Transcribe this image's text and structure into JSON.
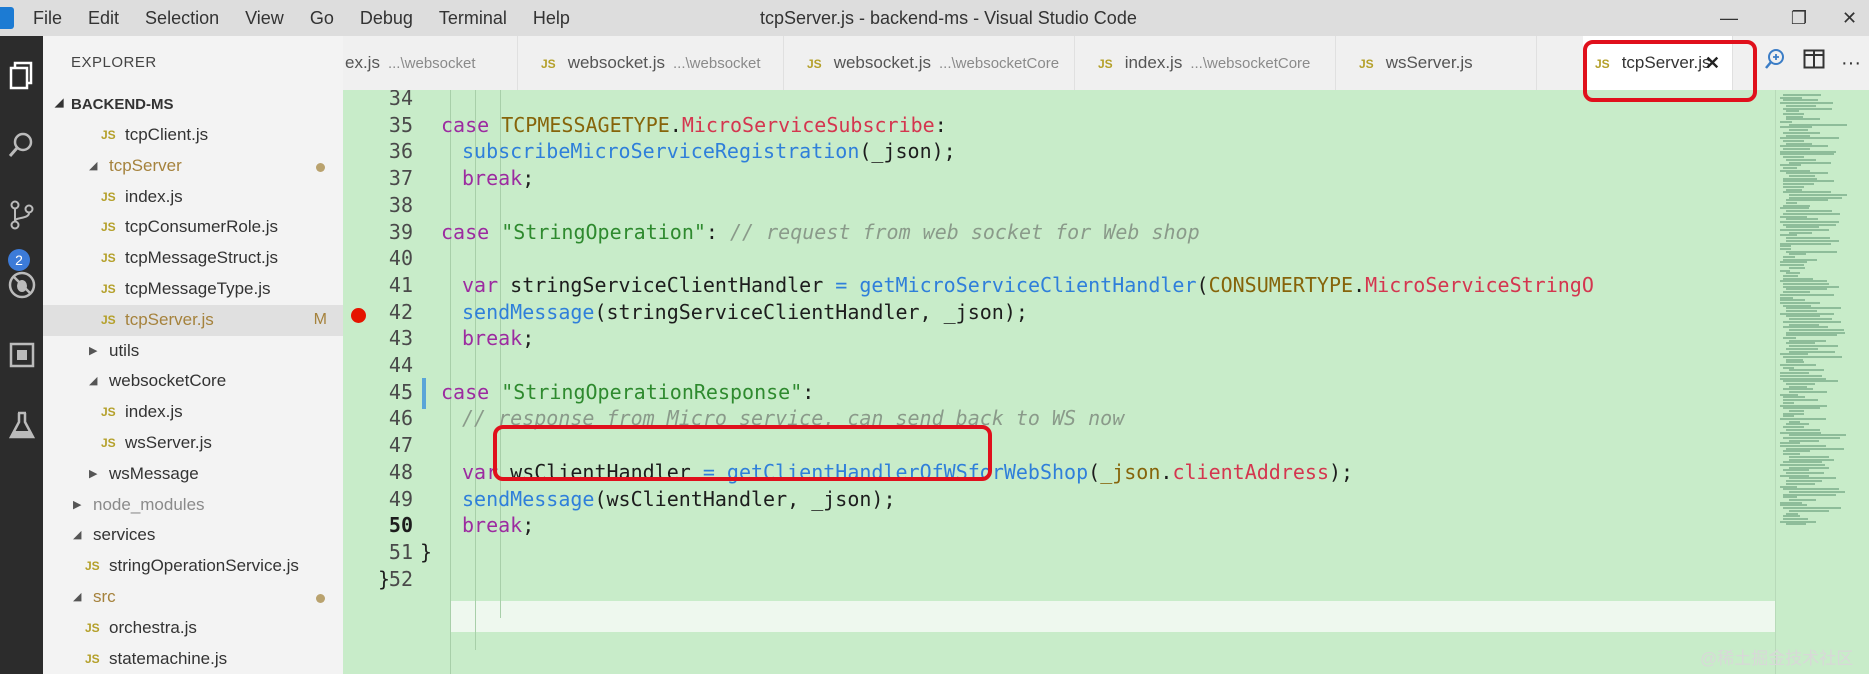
{
  "window": {
    "title": "tcpServer.js - backend-ms - Visual Studio Code",
    "menu": [
      "File",
      "Edit",
      "Selection",
      "View",
      "Go",
      "Debug",
      "Terminal",
      "Help"
    ],
    "controls": {
      "minimize": "—",
      "restore": "❐",
      "close": "✕"
    }
  },
  "activity_bar": {
    "icons": [
      "explorer-icon",
      "search-icon",
      "source-control-icon",
      "debug-icon",
      "extensions-icon",
      "test-icon"
    ],
    "scm_badge": "2"
  },
  "sidebar": {
    "title": "EXPLORER",
    "section": "BACKEND-MS",
    "tree": [
      {
        "label": "tcpClient.js",
        "type": "file",
        "depth": 3
      },
      {
        "label": "tcpServer",
        "type": "folder",
        "depth": 2,
        "open": true,
        "modified": true,
        "color": "orange"
      },
      {
        "label": "index.js",
        "type": "file",
        "depth": 3
      },
      {
        "label": "tcpConsumerRole.js",
        "type": "file",
        "depth": 3
      },
      {
        "label": "tcpMessageStruct.js",
        "type": "file",
        "depth": 3
      },
      {
        "label": "tcpMessageType.js",
        "type": "file",
        "depth": 3
      },
      {
        "label": "tcpServer.js",
        "type": "file",
        "depth": 3,
        "selected": true,
        "mark": "M",
        "color": "orange"
      },
      {
        "label": "utils",
        "type": "folder",
        "depth": 2,
        "open": false
      },
      {
        "label": "websocketCore",
        "type": "folder",
        "depth": 2,
        "open": true
      },
      {
        "label": "index.js",
        "type": "file",
        "depth": 3
      },
      {
        "label": "wsServer.js",
        "type": "file",
        "depth": 3
      },
      {
        "label": "wsMessage",
        "type": "folder",
        "depth": 2,
        "open": false
      },
      {
        "label": "node_modules",
        "type": "folder",
        "depth": 1,
        "open": false,
        "color": "muted"
      },
      {
        "label": "services",
        "type": "folder",
        "depth": 1,
        "open": true
      },
      {
        "label": "stringOperationService.js",
        "type": "file",
        "depth": 2
      },
      {
        "label": "src",
        "type": "folder",
        "depth": 1,
        "open": true,
        "modified": true,
        "color": "orange"
      },
      {
        "label": "orchestra.js",
        "type": "file",
        "depth": 2
      },
      {
        "label": "statemachine.js",
        "type": "file",
        "depth": 2
      }
    ]
  },
  "tabs": [
    {
      "name": "ex.js",
      "path": "...\\websocket",
      "icon": ""
    },
    {
      "name": "websocket.js",
      "path": "...\\websocket",
      "icon": "JS"
    },
    {
      "name": "websocket.js",
      "path": "...\\websocketCore",
      "icon": "JS"
    },
    {
      "name": "index.js",
      "path": "...\\websocketCore",
      "icon": "JS"
    },
    {
      "name": "wsServer.js",
      "path": "",
      "icon": "JS"
    },
    {
      "name": "tcpServer.js",
      "path": "",
      "icon": "JS",
      "active": true,
      "close": "✕"
    }
  ],
  "editor": {
    "current_line": "50",
    "breakpoint_line": "42",
    "lines": [
      {
        "n": "34",
        "tokens": []
      },
      {
        "n": "35",
        "tokens": [
          [
            "kw",
            "case "
          ],
          [
            "ty",
            "TCPMESSAGETYPE"
          ],
          [
            "",
            "."
          ],
          [
            "pr",
            "MicroServiceSubscribe"
          ],
          [
            "",
            ":"
          ]
        ],
        "indent": 3
      },
      {
        "n": "36",
        "tokens": [
          [
            "fn",
            "subscribeMicroServiceRegistration"
          ],
          [
            "",
            "(_json);"
          ]
        ],
        "indent": 4
      },
      {
        "n": "37",
        "tokens": [
          [
            "kw",
            "break"
          ],
          [
            "",
            ";"
          ]
        ],
        "indent": 4
      },
      {
        "n": "38",
        "tokens": []
      },
      {
        "n": "39",
        "tokens": [
          [
            "kw",
            "case "
          ],
          [
            "st",
            "\"StringOperation\""
          ],
          [
            "",
            ": "
          ],
          [
            "cm",
            "// request from web socket for Web shop"
          ]
        ],
        "indent": 3
      },
      {
        "n": "40",
        "tokens": []
      },
      {
        "n": "41",
        "tokens": [
          [
            "kw",
            "var "
          ],
          [
            "",
            "stringServiceClientHandler "
          ],
          [
            "fn",
            "= getMicroServiceClientHandler"
          ],
          [
            "",
            "("
          ],
          [
            "ty",
            "CONSUMERTYPE"
          ],
          [
            "",
            "."
          ],
          [
            "pr",
            "MicroServiceStringO"
          ]
        ],
        "indent": 4
      },
      {
        "n": "42",
        "tokens": [
          [
            "fn",
            "sendMessage"
          ],
          [
            "",
            "(stringServiceClientHandler, _json);"
          ]
        ],
        "indent": 4
      },
      {
        "n": "43",
        "tokens": [
          [
            "kw",
            "break"
          ],
          [
            "",
            ";"
          ]
        ],
        "indent": 4
      },
      {
        "n": "44",
        "tokens": []
      },
      {
        "n": "45",
        "tokens": [
          [
            "kw",
            "case "
          ],
          [
            "st",
            "\"StringOperationResponse\""
          ],
          [
            "",
            ":"
          ]
        ],
        "indent": 3
      },
      {
        "n": "46",
        "tokens": [
          [
            "cm",
            "// response from Micro service, can send back to WS now"
          ]
        ],
        "indent": 4
      },
      {
        "n": "47",
        "tokens": []
      },
      {
        "n": "48",
        "tokens": [
          [
            "kw",
            "var "
          ],
          [
            "",
            "wsClientHandler "
          ],
          [
            "fn",
            "= getClientHandlerOfWSforWebShop"
          ],
          [
            "",
            "("
          ],
          [
            "ty",
            "_json"
          ],
          [
            "",
            "."
          ],
          [
            "pr",
            "clientAddress"
          ],
          [
            "",
            ");"
          ]
        ],
        "indent": 4
      },
      {
        "n": "49",
        "tokens": [
          [
            "fn",
            "sendMessage"
          ],
          [
            "",
            "(wsClientHandler, _json);"
          ]
        ],
        "indent": 4
      },
      {
        "n": "50",
        "tokens": [
          [
            "kw",
            "break"
          ],
          [
            "",
            ";"
          ]
        ],
        "indent": 4
      },
      {
        "n": "51",
        "tokens": [
          [
            "",
            "}"
          ]
        ],
        "indent": 2
      },
      {
        "n": "52",
        "tokens": [
          [
            "",
            "}"
          ]
        ],
        "indent": 0
      }
    ]
  },
  "watermark": "@稀土掘金技术社区"
}
